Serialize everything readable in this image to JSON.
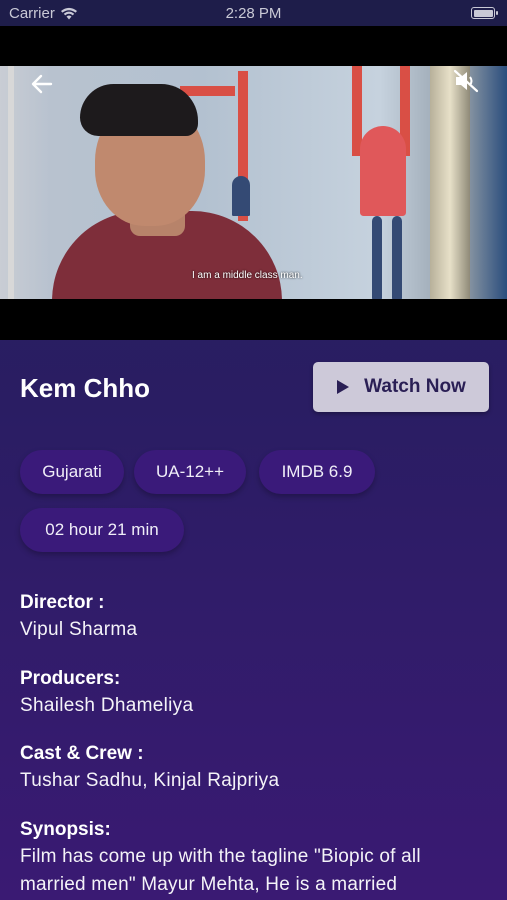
{
  "status_bar": {
    "carrier": "Carrier",
    "time": "2:28 PM"
  },
  "video": {
    "subtitle": "I am a middle class man."
  },
  "movie": {
    "title": "Kem Chho",
    "watch_label": "Watch Now"
  },
  "chips": [
    "Gujarati",
    "UA-12++",
    "IMDB 6.9",
    "02 hour 21 min"
  ],
  "details": {
    "director_label": "Director :",
    "director": "Vipul Sharma",
    "producers_label": "Producers:",
    "producers": "Shailesh Dhameliya",
    "cast_label": "Cast & Crew :",
    "cast": "Tushar Sadhu, Kinjal Rajpriya",
    "synopsis_label": "Synopsis:",
    "synopsis": "Film has come up with the tagline \"Biopic of all married men\" Mayur Mehta, He is a married"
  },
  "icons": {
    "back": "arrow-left-icon",
    "mute": "volume-mute-icon",
    "play": "play-icon",
    "wifi": "wifi-icon",
    "battery": "battery-icon"
  },
  "colors": {
    "chip_bg": "#3a1a7a",
    "button_bg": "#cdc9d9",
    "button_text": "#2a1f55"
  }
}
